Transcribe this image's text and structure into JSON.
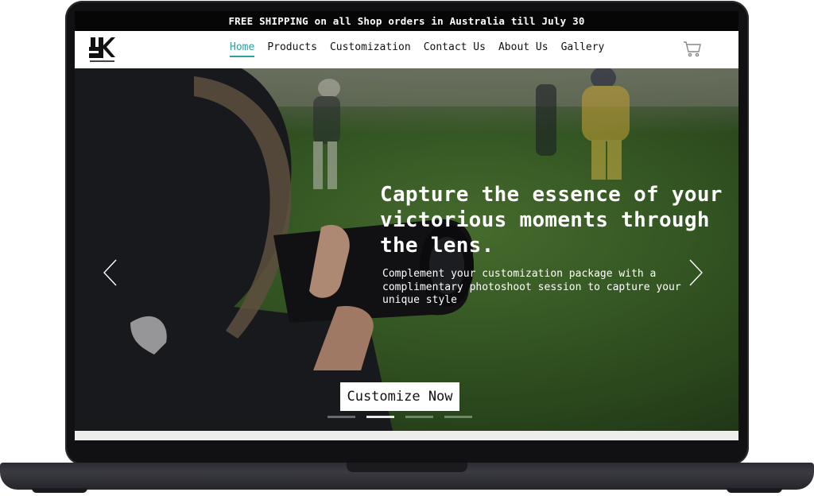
{
  "banner": {
    "text": "FREE SHIPPING on all Shop orders in Australia till July 30"
  },
  "brand": {
    "logo_icon": "jk-monogram-logo"
  },
  "nav": {
    "items": [
      {
        "label": "Home",
        "active": true
      },
      {
        "label": "Products",
        "active": false
      },
      {
        "label": "Customization",
        "active": false
      },
      {
        "label": "Contact Us",
        "active": false
      },
      {
        "label": "About Us",
        "active": false
      },
      {
        "label": "Gallery",
        "active": false
      }
    ],
    "cart_icon": "cart-icon"
  },
  "hero": {
    "headline": "Capture the essence of your victorious moments through the lens.",
    "subtext": "Complement your customization package with a complimentary photoshoot session to capture your unique style",
    "cta_label": "Customize Now",
    "prev_icon": "chevron-left-icon",
    "next_icon": "chevron-right-icon",
    "slides": 4,
    "active_slide": 2
  },
  "colors": {
    "accent": "#2aa3a3",
    "banner_bg": "#060606",
    "cta_bg": "#ffffff"
  }
}
